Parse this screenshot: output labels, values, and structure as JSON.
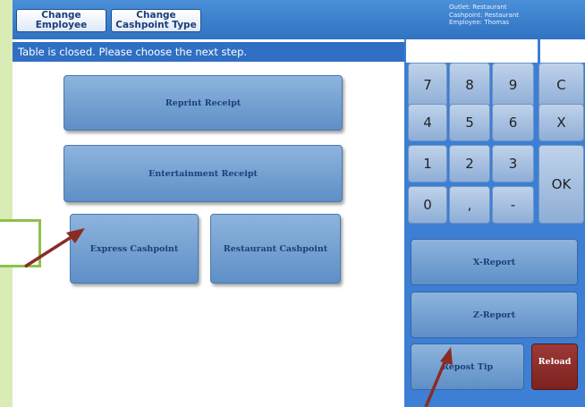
{
  "topbar": {
    "change_employee": "Change Employee",
    "change_cashpoint_type": "Change Cashpoint Type",
    "outlet": "Outlet: Restaurant",
    "cashpoint": "Cashpoint: Restaurant",
    "employee": "Employee: Thomas"
  },
  "message": "Table is closed. Please choose the next step.",
  "actions": {
    "reprint_receipt": "Reprint Receipt",
    "entertainment_receipt": "Entertainment Receipt",
    "express_cashpoint": "Express Cashpoint",
    "restaurant_cashpoint": "Restaurant Cashpoint"
  },
  "keypad": {
    "k7": "7",
    "k8": "8",
    "k9": "9",
    "clear": "C",
    "k4": "4",
    "k5": "5",
    "k6": "6",
    "x": "X",
    "k1": "1",
    "k2": "2",
    "k3": "3",
    "ok": "OK",
    "k0": "0",
    "comma": ",",
    "minus": "-"
  },
  "side_buttons": {
    "x_report": "X-Report",
    "z_report": "Z-Report",
    "repost_tip": "Repost Tip",
    "reload": "Reload"
  },
  "colors": {
    "accent_blue": "#3c7fd4",
    "arrow": "#8b2b24",
    "callout_green": "#8fc04a",
    "reload_red": "#8b2b24"
  }
}
